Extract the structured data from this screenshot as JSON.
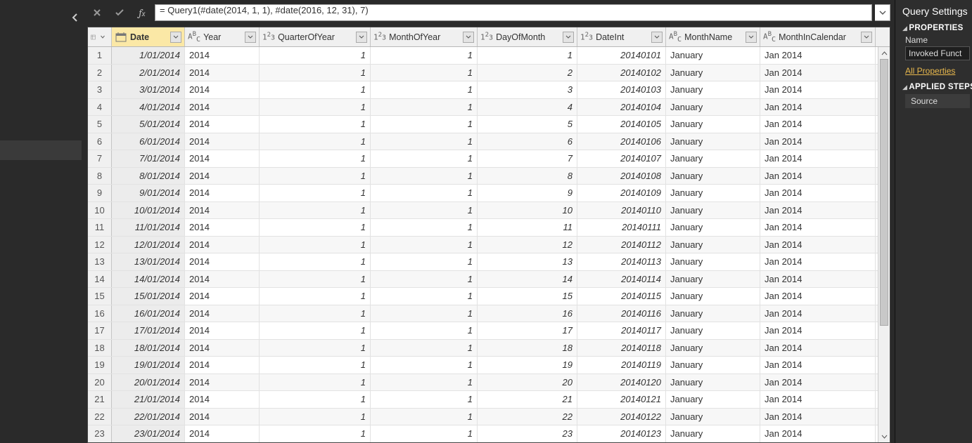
{
  "formula": {
    "text": "= Query1(#date(2014, 1, 1), #date(2016, 12, 31), 7)"
  },
  "columns": [
    {
      "key": "Date",
      "label": "Date",
      "type": "date",
      "cls": "c-date",
      "align": "right",
      "italic": true,
      "selected": true
    },
    {
      "key": "Year",
      "label": "Year",
      "type": "text",
      "cls": "c-year",
      "align": "left",
      "italic": false,
      "selected": false
    },
    {
      "key": "QuarterOfYear",
      "label": "QuarterOfYear",
      "type": "int",
      "cls": "c-qoy",
      "align": "right",
      "italic": true,
      "selected": false
    },
    {
      "key": "MonthOfYear",
      "label": "MonthOfYear",
      "type": "int",
      "cls": "c-moy",
      "align": "right",
      "italic": true,
      "selected": false
    },
    {
      "key": "DayOfMonth",
      "label": "DayOfMonth",
      "type": "int",
      "cls": "c-dom",
      "align": "right",
      "italic": true,
      "selected": false
    },
    {
      "key": "DateInt",
      "label": "DateInt",
      "type": "int",
      "cls": "c-dint",
      "align": "right",
      "italic": true,
      "selected": false
    },
    {
      "key": "MonthName",
      "label": "MonthName",
      "type": "text",
      "cls": "c-mname",
      "align": "left",
      "italic": false,
      "selected": false
    },
    {
      "key": "MonthInCalendar",
      "label": "MonthInCalendar",
      "type": "text",
      "cls": "c-mic",
      "align": "left",
      "italic": false,
      "selected": false
    }
  ],
  "rows": [
    {
      "n": 1,
      "Date": "1/01/2014",
      "Year": "2014",
      "QuarterOfYear": "1",
      "MonthOfYear": "1",
      "DayOfMonth": "1",
      "DateInt": "20140101",
      "MonthName": "January",
      "MonthInCalendar": "Jan 2014"
    },
    {
      "n": 2,
      "Date": "2/01/2014",
      "Year": "2014",
      "QuarterOfYear": "1",
      "MonthOfYear": "1",
      "DayOfMonth": "2",
      "DateInt": "20140102",
      "MonthName": "January",
      "MonthInCalendar": "Jan 2014"
    },
    {
      "n": 3,
      "Date": "3/01/2014",
      "Year": "2014",
      "QuarterOfYear": "1",
      "MonthOfYear": "1",
      "DayOfMonth": "3",
      "DateInt": "20140103",
      "MonthName": "January",
      "MonthInCalendar": "Jan 2014"
    },
    {
      "n": 4,
      "Date": "4/01/2014",
      "Year": "2014",
      "QuarterOfYear": "1",
      "MonthOfYear": "1",
      "DayOfMonth": "4",
      "DateInt": "20140104",
      "MonthName": "January",
      "MonthInCalendar": "Jan 2014"
    },
    {
      "n": 5,
      "Date": "5/01/2014",
      "Year": "2014",
      "QuarterOfYear": "1",
      "MonthOfYear": "1",
      "DayOfMonth": "5",
      "DateInt": "20140105",
      "MonthName": "January",
      "MonthInCalendar": "Jan 2014"
    },
    {
      "n": 6,
      "Date": "6/01/2014",
      "Year": "2014",
      "QuarterOfYear": "1",
      "MonthOfYear": "1",
      "DayOfMonth": "6",
      "DateInt": "20140106",
      "MonthName": "January",
      "MonthInCalendar": "Jan 2014"
    },
    {
      "n": 7,
      "Date": "7/01/2014",
      "Year": "2014",
      "QuarterOfYear": "1",
      "MonthOfYear": "1",
      "DayOfMonth": "7",
      "DateInt": "20140107",
      "MonthName": "January",
      "MonthInCalendar": "Jan 2014"
    },
    {
      "n": 8,
      "Date": "8/01/2014",
      "Year": "2014",
      "QuarterOfYear": "1",
      "MonthOfYear": "1",
      "DayOfMonth": "8",
      "DateInt": "20140108",
      "MonthName": "January",
      "MonthInCalendar": "Jan 2014"
    },
    {
      "n": 9,
      "Date": "9/01/2014",
      "Year": "2014",
      "QuarterOfYear": "1",
      "MonthOfYear": "1",
      "DayOfMonth": "9",
      "DateInt": "20140109",
      "MonthName": "January",
      "MonthInCalendar": "Jan 2014"
    },
    {
      "n": 10,
      "Date": "10/01/2014",
      "Year": "2014",
      "QuarterOfYear": "1",
      "MonthOfYear": "1",
      "DayOfMonth": "10",
      "DateInt": "20140110",
      "MonthName": "January",
      "MonthInCalendar": "Jan 2014"
    },
    {
      "n": 11,
      "Date": "11/01/2014",
      "Year": "2014",
      "QuarterOfYear": "1",
      "MonthOfYear": "1",
      "DayOfMonth": "11",
      "DateInt": "20140111",
      "MonthName": "January",
      "MonthInCalendar": "Jan 2014"
    },
    {
      "n": 12,
      "Date": "12/01/2014",
      "Year": "2014",
      "QuarterOfYear": "1",
      "MonthOfYear": "1",
      "DayOfMonth": "12",
      "DateInt": "20140112",
      "MonthName": "January",
      "MonthInCalendar": "Jan 2014"
    },
    {
      "n": 13,
      "Date": "13/01/2014",
      "Year": "2014",
      "QuarterOfYear": "1",
      "MonthOfYear": "1",
      "DayOfMonth": "13",
      "DateInt": "20140113",
      "MonthName": "January",
      "MonthInCalendar": "Jan 2014"
    },
    {
      "n": 14,
      "Date": "14/01/2014",
      "Year": "2014",
      "QuarterOfYear": "1",
      "MonthOfYear": "1",
      "DayOfMonth": "14",
      "DateInt": "20140114",
      "MonthName": "January",
      "MonthInCalendar": "Jan 2014"
    },
    {
      "n": 15,
      "Date": "15/01/2014",
      "Year": "2014",
      "QuarterOfYear": "1",
      "MonthOfYear": "1",
      "DayOfMonth": "15",
      "DateInt": "20140115",
      "MonthName": "January",
      "MonthInCalendar": "Jan 2014"
    },
    {
      "n": 16,
      "Date": "16/01/2014",
      "Year": "2014",
      "QuarterOfYear": "1",
      "MonthOfYear": "1",
      "DayOfMonth": "16",
      "DateInt": "20140116",
      "MonthName": "January",
      "MonthInCalendar": "Jan 2014"
    },
    {
      "n": 17,
      "Date": "17/01/2014",
      "Year": "2014",
      "QuarterOfYear": "1",
      "MonthOfYear": "1",
      "DayOfMonth": "17",
      "DateInt": "20140117",
      "MonthName": "January",
      "MonthInCalendar": "Jan 2014"
    },
    {
      "n": 18,
      "Date": "18/01/2014",
      "Year": "2014",
      "QuarterOfYear": "1",
      "MonthOfYear": "1",
      "DayOfMonth": "18",
      "DateInt": "20140118",
      "MonthName": "January",
      "MonthInCalendar": "Jan 2014"
    },
    {
      "n": 19,
      "Date": "19/01/2014",
      "Year": "2014",
      "QuarterOfYear": "1",
      "MonthOfYear": "1",
      "DayOfMonth": "19",
      "DateInt": "20140119",
      "MonthName": "January",
      "MonthInCalendar": "Jan 2014"
    },
    {
      "n": 20,
      "Date": "20/01/2014",
      "Year": "2014",
      "QuarterOfYear": "1",
      "MonthOfYear": "1",
      "DayOfMonth": "20",
      "DateInt": "20140120",
      "MonthName": "January",
      "MonthInCalendar": "Jan 2014"
    },
    {
      "n": 21,
      "Date": "21/01/2014",
      "Year": "2014",
      "QuarterOfYear": "1",
      "MonthOfYear": "1",
      "DayOfMonth": "21",
      "DateInt": "20140121",
      "MonthName": "January",
      "MonthInCalendar": "Jan 2014"
    },
    {
      "n": 22,
      "Date": "22/01/2014",
      "Year": "2014",
      "QuarterOfYear": "1",
      "MonthOfYear": "1",
      "DayOfMonth": "22",
      "DateInt": "20140122",
      "MonthName": "January",
      "MonthInCalendar": "Jan 2014"
    },
    {
      "n": 23,
      "Date": "23/01/2014",
      "Year": "2014",
      "QuarterOfYear": "1",
      "MonthOfYear": "1",
      "DayOfMonth": "23",
      "DateInt": "20140123",
      "MonthName": "January",
      "MonthInCalendar": "Jan 2014"
    }
  ],
  "rightPanel": {
    "title": "Query Settings",
    "propsHeader": "PROPERTIES",
    "nameLabel": "Name",
    "nameValue": "Invoked Funct",
    "allPropsLink": "All Properties",
    "stepsHeader": "APPLIED STEPS",
    "step1": "Source"
  }
}
